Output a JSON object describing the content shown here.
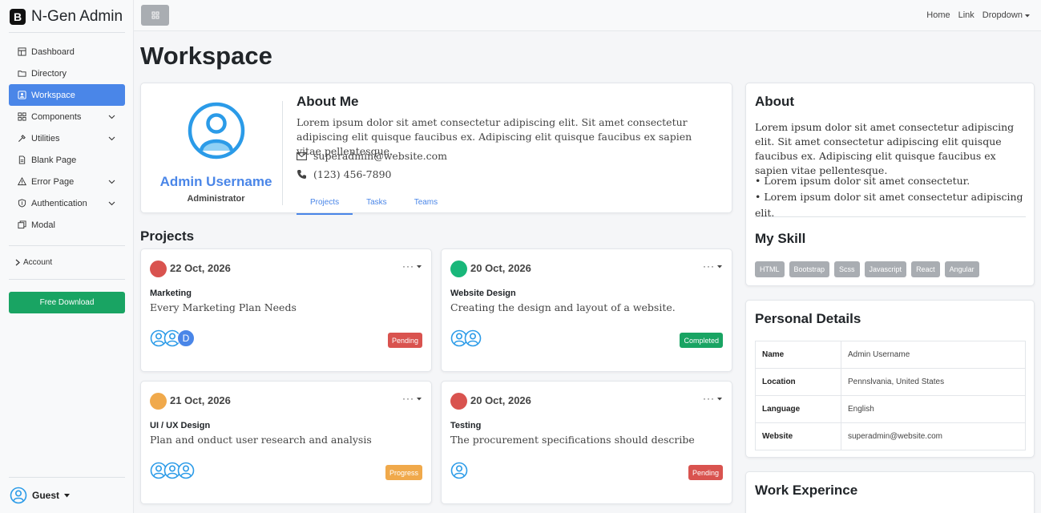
{
  "brand": {
    "logo": "B",
    "name": "N-Gen Admin"
  },
  "sidebar": {
    "items": [
      {
        "label": "Dashboard",
        "icon": "dashboard-icon"
      },
      {
        "label": "Directory",
        "icon": "folder-icon"
      },
      {
        "label": "Workspace",
        "icon": "workspace-icon",
        "active": true
      },
      {
        "label": "Components",
        "icon": "components-icon",
        "expandable": true
      },
      {
        "label": "Utilities",
        "icon": "tools-icon",
        "expandable": true
      },
      {
        "label": "Blank Page",
        "icon": "file-icon"
      },
      {
        "label": "Error Page",
        "icon": "warning-icon",
        "expandable": true
      },
      {
        "label": "Authentication",
        "icon": "shield-icon",
        "expandable": true
      },
      {
        "label": "Modal",
        "icon": "modal-icon"
      }
    ],
    "account": "Account",
    "free_download": "Free Download",
    "user": "Guest"
  },
  "topnav": {
    "home": "Home",
    "link": "Link",
    "dropdown": "Dropdown"
  },
  "page": {
    "title": "Workspace"
  },
  "profile": {
    "name": "Admin Username",
    "role": "Administrator",
    "about_title": "About Me",
    "about_text": "Lorem ipsum dolor sit amet consectetur adipiscing elit. Sit amet consectetur adipiscing elit quisque faucibus ex. Adipiscing elit quisque faucibus ex sapien vitae pellentesque.",
    "email": "superadmin@website.com",
    "phone": "(123) 456-7890",
    "tabs": [
      "Projects",
      "Tasks",
      "Teams"
    ]
  },
  "projects": {
    "title": "Projects",
    "items": [
      {
        "date": "22 Oct, 2026",
        "dot": "#d9534f",
        "title": "Marketing",
        "desc": "Every Marketing Plan Needs",
        "status": "Pending",
        "status_color": "#d9534f",
        "members": 2,
        "extra_member": "D"
      },
      {
        "date": "20 Oct, 2026",
        "dot": "#19b77a",
        "title": "Website Design",
        "desc": "Creating the design and layout of a website.",
        "status": "Completed",
        "status_color": "#19a463",
        "members": 2,
        "extra_member": ""
      },
      {
        "date": "21 Oct, 2026",
        "dot": "#f0a94b",
        "title": "UI / UX Design",
        "desc": "Plan and onduct user research and analysis",
        "status": "Progress",
        "status_color": "#f0a94b",
        "members": 3,
        "extra_member": ""
      },
      {
        "date": "20 Oct, 2026",
        "dot": "#d9534f",
        "title": "Testing",
        "desc": "The procurement specifications should describe",
        "status": "Pending",
        "status_color": "#d9534f",
        "members": 1,
        "extra_member": ""
      }
    ]
  },
  "about": {
    "title": "About",
    "text": "Lorem ipsum dolor sit amet consectetur adipiscing elit. Sit amet consectetur adipiscing elit quisque faucibus ex. Adipiscing elit quisque faucibus ex sapien vitae pellentesque.",
    "list": [
      "Lorem ipsum dolor sit amet consectetur.",
      "Lorem ipsum dolor sit amet consectetur adipiscing elit."
    ],
    "skills_title": "My Skill",
    "skills": [
      "HTML",
      "Bootstrap",
      "Scss",
      "Javascript",
      "React",
      "Angular"
    ]
  },
  "personal": {
    "title": "Personal Details",
    "rows": [
      {
        "key": "Name",
        "value": "Admin Username"
      },
      {
        "key": "Location",
        "value": "Pennslvania, United States"
      },
      {
        "key": "Language",
        "value": "English"
      },
      {
        "key": "Website",
        "value": "superadmin@website.com"
      }
    ]
  },
  "work": {
    "title": "Work Experince"
  },
  "colors": {
    "primary": "#4a86e8",
    "success": "#19a463",
    "secondary": "#a9adb2"
  }
}
